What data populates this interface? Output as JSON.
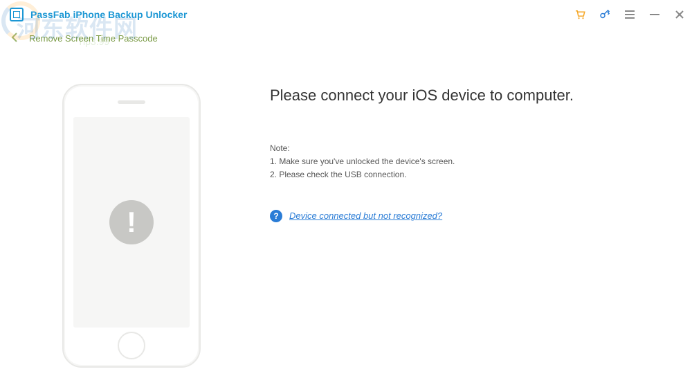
{
  "titlebar": {
    "app_title": "PassFab iPhone Backup Unlocker"
  },
  "breadcrumb": {
    "text": "Remove Screen Time Passcode"
  },
  "main": {
    "headline": "Please connect your iOS device to computer.",
    "note_heading": "Note:",
    "note_1": "1. Make sure you've unlocked the device's screen.",
    "note_2": "2. Please check the USB connection.",
    "help_link": "Device connected but not recognized?"
  },
  "watermark": {
    "line1": "河东软件网",
    "line2": "Tip3:99"
  }
}
